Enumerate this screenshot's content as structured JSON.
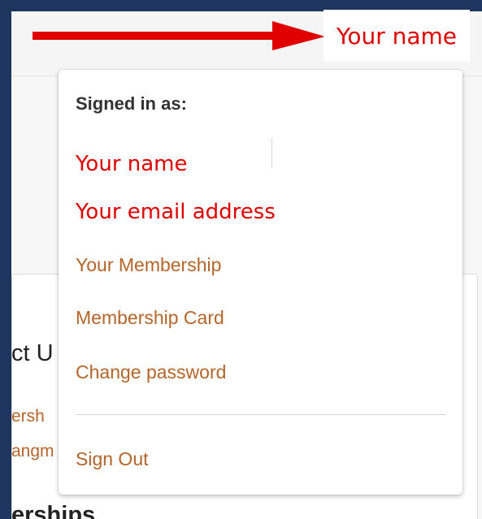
{
  "annotation": {
    "name_tag": "Your name",
    "arrow_color": "#e00000"
  },
  "dropdown": {
    "header": "Signed in as:",
    "user_name": "Your name",
    "user_email": "Your email address",
    "items": [
      {
        "label": "Your Membership"
      },
      {
        "label": "Membership Card"
      },
      {
        "label": "Change password"
      },
      {
        "label": "Sign Out"
      }
    ],
    "link_color": "#b5652a"
  },
  "background_page": {
    "heading_fragment": "ct U",
    "link_fragment_1": "ersh",
    "link_fragment_2": "angm",
    "heading2_fragment": "erships"
  }
}
